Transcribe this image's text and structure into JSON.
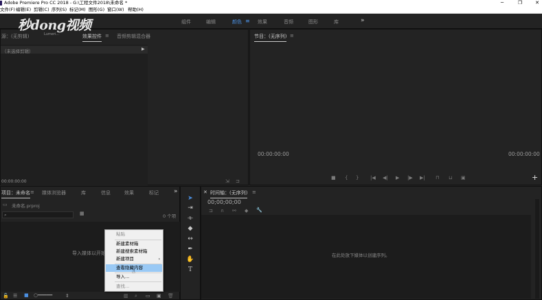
{
  "window": {
    "title": "Adobe Premiere Pro CC 2018 - G:\\工程文件2018\\未命名 *",
    "minimize": "─",
    "maximize": "❐",
    "close": "✕"
  },
  "menubar": [
    "文件(F)",
    "编辑(E)",
    "剪辑(C)",
    "序列(S)",
    "标记(M)",
    "图形(G)",
    "窗口(W)",
    "帮助(H)"
  ],
  "workspaces": {
    "items": [
      "组件",
      "编辑",
      "颜色",
      "效果",
      "音频",
      "图形",
      "库"
    ],
    "active_index": 2,
    "more": "»"
  },
  "watermark": {
    "text": "秒dong视频",
    "url": "Lumeri..."
  },
  "source_panel": {
    "tabs": [
      "源：(无剪辑)",
      "效果控件",
      "音频剪辑混合器"
    ],
    "active_tab": 1,
    "no_clip": "（未选择剪辑）",
    "timecode": "00:00:00:00"
  },
  "program_panel": {
    "title": "节目：(无序列)",
    "timecode_left": "00:00:00:00",
    "timecode_right": "00:00:00:00",
    "add": "+"
  },
  "project_panel": {
    "tabs": [
      "项目：未命名",
      "媒体浏览器",
      "库",
      "信息",
      "效果",
      "标记"
    ],
    "active_tab": 0,
    "more": "»",
    "file_name": "未命名.prproj",
    "item_count": "0 个项",
    "import_hint": "导入媒体以开始"
  },
  "timeline_panel": {
    "title": "时间轴：(无序列)",
    "timecode": "00;00;00;00",
    "hint": "在此处放下媒体以创建序列。"
  },
  "context_menu": {
    "items": [
      {
        "label": "粘贴",
        "enabled": false
      },
      {
        "label": "新建素材箱",
        "enabled": true
      },
      {
        "label": "新建搜索素材箱",
        "enabled": true
      },
      {
        "label": "新建项目",
        "enabled": true,
        "submenu": true
      },
      {
        "label": "查看隐藏内容",
        "enabled": true,
        "hover": true
      },
      {
        "label": "导入...",
        "enabled": true
      },
      {
        "label": "查找...",
        "enabled": false
      }
    ],
    "submenu_arrow": "›"
  },
  "colors": {
    "accent_blue": "#4b8fe0",
    "menu_hover": "#99c9f5",
    "panel_bg": "#232323"
  }
}
